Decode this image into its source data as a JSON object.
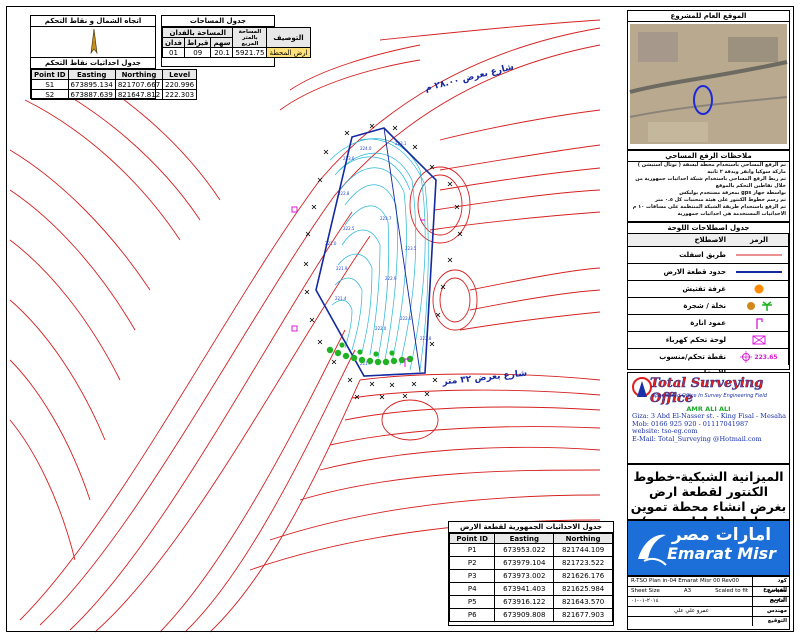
{
  "north_box": {
    "title": "اتجاه الشمال و نقاط التحكم"
  },
  "control_points": {
    "title": "جدول احداثيات نقاط التحكم",
    "headers": [
      "Point ID",
      "Easting",
      "Northing",
      "Level"
    ],
    "rows": [
      [
        "S1",
        "673895.134",
        "821707.667",
        "220.996"
      ],
      [
        "S2",
        "673887.639",
        "821647.812",
        "222.303"
      ]
    ]
  },
  "area_table": {
    "title": "جدول المساحات",
    "h_desc": "التوصيف",
    "h_sqm": "المساحة بالمتر المربع",
    "h_feddan": "المساحة بالفدان",
    "h_sahm": "سهم",
    "h_qirat": "قيراط",
    "h_fed": "فدان",
    "row_desc": "ارض المحطة",
    "row_sqm": "5921.75",
    "row_sahm": "20.1",
    "row_qirat": "09",
    "row_fed": "01"
  },
  "map": {
    "street_top": "شارع بعرض ٢٨.٠٠ م",
    "street_bottom": "شارع بعرض ٣٢ متر"
  },
  "location": {
    "title": "الموقع العام للمشروع"
  },
  "notes": {
    "title": "ملاحظات الرفع المساحي",
    "lines": [
      "تم الرفع المساحي باستخدام محطة ليسفة ( توتال استيشن ) ماركة سوكيا وايفر وبدقة ٢ ثانية",
      "تم ربط الرفع المساحي باستخدام شبكة احداثيات جمهورية من خلال نقاطين التحكم بالموقع",
      "بواسطة جهاز gps بمعرفة مستخدم بوليكس",
      "تم رسم خطوط الكنتور على هيئة منحنيات كل ٠.٥ متر",
      "تم الرفع باستخدام طريقة الشبكة المنتظمة على مسافات ١٠ م",
      "الاحداثيات المستخدمة هي احداثيات جمهورية"
    ]
  },
  "legend": {
    "title": "جدول اصطلاحات اللوحة",
    "h_symbol": "الرمز",
    "h_term": "الاصطلاح",
    "items": [
      {
        "label": "طريق اسفلت"
      },
      {
        "label": "حدود قطعة الارض"
      },
      {
        "label": "غرفة تفتيش"
      },
      {
        "label": "نخلة / شجرة"
      },
      {
        "label": "عمود انارة"
      },
      {
        "label": "لوحة تحكم كهرباء"
      },
      {
        "label": "نقطة تحكم/منسوب الاسفلت",
        "value": "223.65"
      }
    ]
  },
  "company": {
    "name": "Total Surveying Office",
    "tagline": "Specialized Office In Survey Engineering Field",
    "owner": "AMR ALI ALI",
    "address": "Giza: 3 Abd El-Nasser st. - King Fisal - Mesaha",
    "mob": "Mob: 0166 925 920  -  01117041987",
    "website": "website: tso-eg.com",
    "email": "E-Mail: Total_Surveying @Hotmail.com"
  },
  "project_title": "الميزانية الشبكية-خطوط الكنتور لقطعة ارض بغرض انشاء محطة تموين سيارات (امارات مصر)",
  "client": {
    "ar": "امارات مصر",
    "en": "Emarat Misr"
  },
  "meta": {
    "k_code": "كود المشروع",
    "v_code": "R-TSO Plan in-04 Emarat Misr 00 Rev00",
    "k_scale": "مقياس الرسم",
    "v_scale": "Scaled to fit",
    "k_sheet": "Sheet Size",
    "v_sheet": "A3",
    "k_date": "التاريخ",
    "v_date": "٢٠١٤-٠١-٠١",
    "k_eng": "مهندس",
    "v_eng": "عمرو علي علي",
    "k_sign": "التوقيع"
  },
  "land_coords": {
    "title": "جدول الاحداثيات الجمهورية لقطعة الارض",
    "headers": [
      "Point ID",
      "Easting",
      "Northing"
    ],
    "rows": [
      [
        "P1",
        "673953.022",
        "821744.109"
      ],
      [
        "P2",
        "673979.104",
        "821723.522"
      ],
      [
        "P3",
        "673973.002",
        "821626.176"
      ],
      [
        "P4",
        "673941.403",
        "821625.984"
      ],
      [
        "P5",
        "673916.122",
        "821643.570"
      ],
      [
        "P6",
        "673909.808",
        "821677.903"
      ]
    ]
  }
}
